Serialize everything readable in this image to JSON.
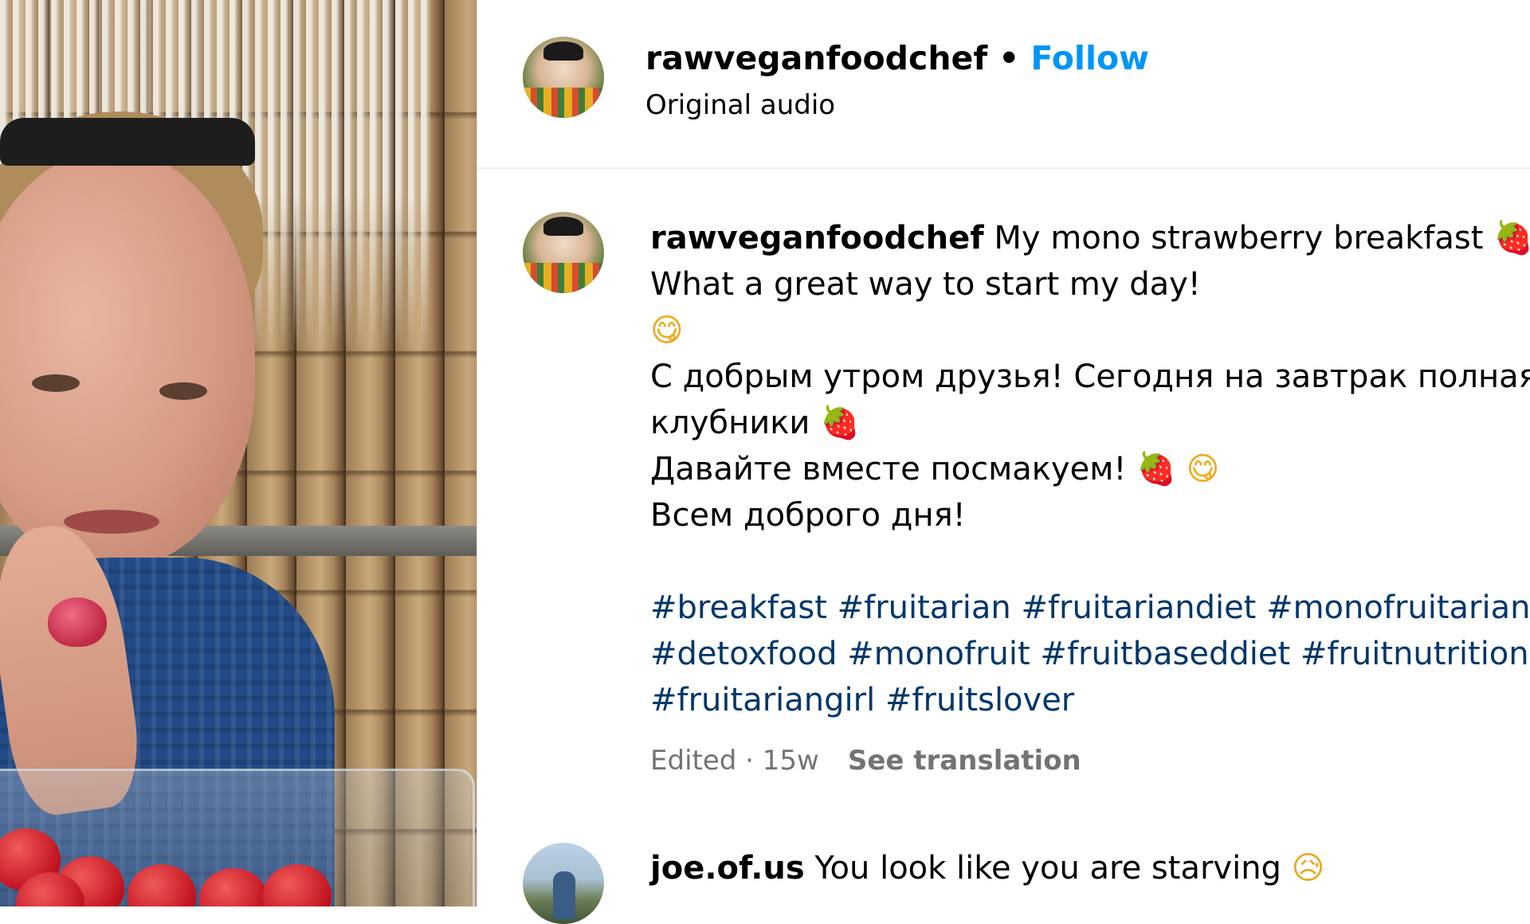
{
  "post": {
    "username": "rawveganfoodchef",
    "separator": "•",
    "follow_label": "Follow",
    "audio": "Original audio"
  },
  "caption": {
    "username": "rawveganfoodchef",
    "line1": "My mono strawberry breakfast",
    "line2": "What a great way to start my day!",
    "line4": "С добрым утром друзья! Сегодня на завтрак полная т",
    "line5": "клубники",
    "line6": "Давайте вместе посмакуем!",
    "line7": "Всем доброго дня!",
    "hashtags_row1": [
      "#breakfast",
      "#fruitarian",
      "#fruitariandiet",
      "#monofruitarian"
    ],
    "hashtags_row2": [
      "#detoxfood",
      "#monofruit",
      "#fruitbaseddiet",
      "#fruitnutrition"
    ],
    "hashtags_row3": [
      "#fruitariangirl",
      "#fruitslover"
    ],
    "meta": "Edited · 15w",
    "see_translation": "See translation"
  },
  "emojis": {
    "strawberry": "🍓",
    "yum": "😋",
    "sad": "😥"
  },
  "comment": {
    "username": "joe.of.us",
    "text": "You look like you are starving"
  },
  "colors": {
    "follow_blue": "#0095f6",
    "hashtag_blue": "#00376b",
    "meta_gray": "#737373"
  }
}
